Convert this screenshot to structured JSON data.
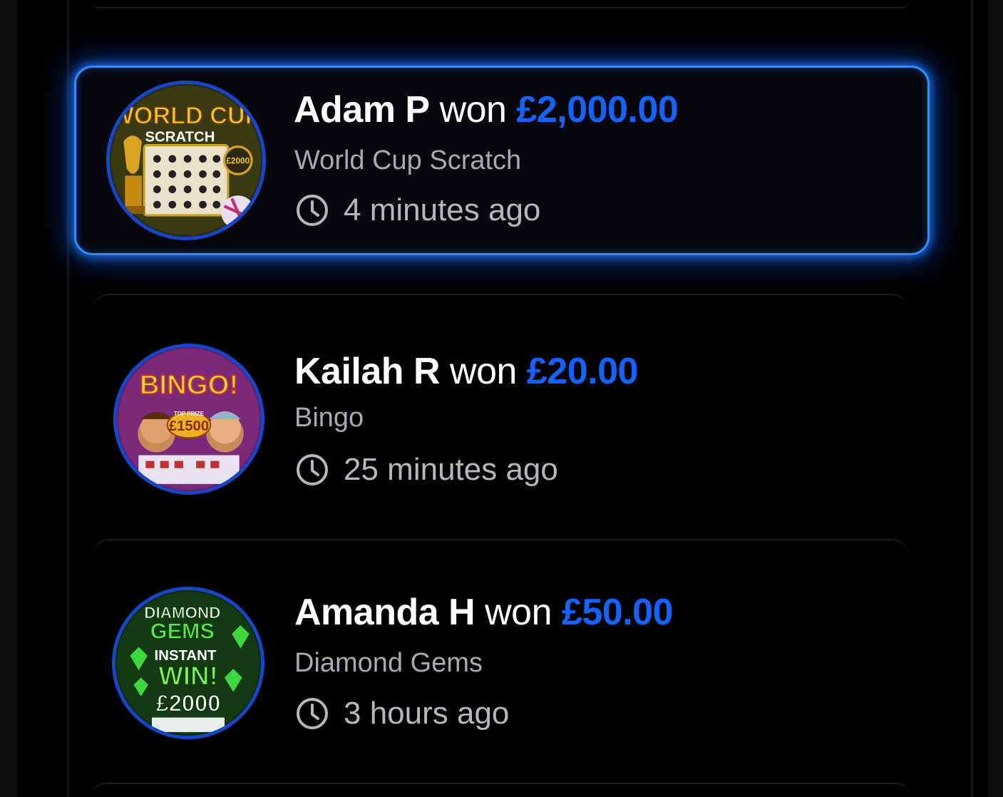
{
  "winners": [
    {
      "name": "Adam P",
      "won_word": "won",
      "amount": "£2,000.00",
      "game": "World Cup Scratch",
      "time": "4 minutes ago",
      "thumbnail_text": [
        "WORLD CUP",
        "SCRATCH",
        "£2000"
      ],
      "highlighted": true
    },
    {
      "name": "Kailah R",
      "won_word": "won",
      "amount": "£20.00",
      "game": "Bingo",
      "time": "25 minutes ago",
      "thumbnail_text": [
        "BINGO!",
        "TOP PRIZE",
        "£1500"
      ],
      "highlighted": false
    },
    {
      "name": "Amanda H",
      "won_word": "won",
      "amount": "£50.00",
      "game": "Diamond Gems",
      "time": "3 hours ago",
      "thumbnail_text": [
        "DIAMOND",
        "GEMS",
        "INSTANT",
        "WIN!",
        "£2000"
      ],
      "highlighted": false
    }
  ],
  "icons": {
    "clock": "clock-icon"
  },
  "colors": {
    "accent": "#1463ff",
    "highlight_border": "#2f8dff",
    "thumb_ring": "#1747c9",
    "background": "#000000"
  }
}
